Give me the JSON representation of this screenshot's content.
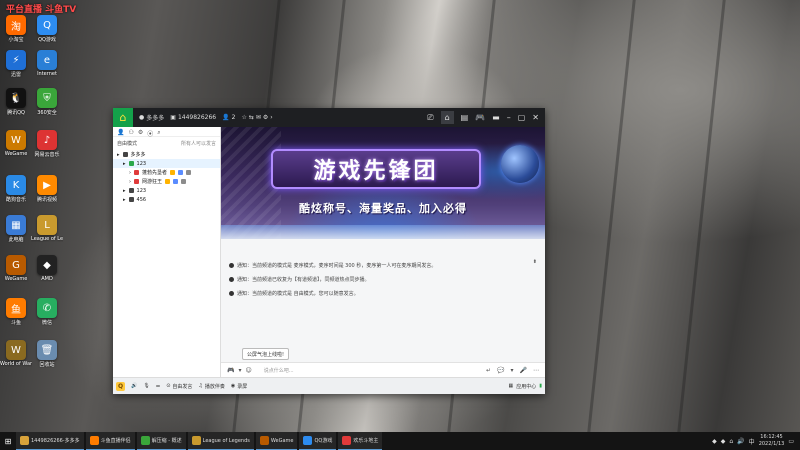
{
  "overlay": {
    "text": "平台直播 斗鱼TV"
  },
  "desktop_icons": [
    {
      "label": "小淘宝",
      "color": "#ff6a00",
      "glyph": "淘"
    },
    {
      "label": "QQ游戏",
      "color": "#2d8cf0",
      "glyph": "Q"
    },
    {
      "label": "迅雷",
      "color": "#1f6fd6",
      "glyph": "⚡"
    },
    {
      "label": "Internet",
      "color": "#2a7fd6",
      "glyph": "e"
    },
    {
      "label": "腾讯QQ",
      "color": "#111",
      "glyph": "🐧"
    },
    {
      "label": "360安全",
      "color": "#3aa63a",
      "glyph": "⛨"
    },
    {
      "label": "WeGame",
      "color": "#cc7a00",
      "glyph": "W"
    },
    {
      "label": "网易云音乐",
      "color": "#d33",
      "glyph": "♪"
    },
    {
      "label": "酷狗音乐",
      "color": "#2a8ae6",
      "glyph": "K"
    },
    {
      "label": "腾讯视频",
      "color": "#ff8a00",
      "glyph": "▶"
    },
    {
      "label": "此电脑",
      "color": "#3a7bd5",
      "glyph": "▦"
    },
    {
      "label": "League of Legends",
      "color": "#c99a2e",
      "glyph": "L"
    },
    {
      "label": "WeGame",
      "color": "#b85a00",
      "glyph": "G"
    },
    {
      "label": "AMD",
      "color": "#222",
      "glyph": "◆"
    },
    {
      "label": "斗鱼",
      "color": "#ff7c00",
      "glyph": "鱼"
    },
    {
      "label": "微信",
      "color": "#27ae60",
      "glyph": "✆"
    },
    {
      "label": "World of Warcraft",
      "color": "#8a6a20",
      "glyph": "W"
    },
    {
      "label": "回收站",
      "color": "#6a8caf",
      "glyph": "🗑"
    }
  ],
  "window": {
    "title_name": "多多多",
    "room_id": "1449826266",
    "members": "2",
    "tool_icons": [
      "screen-icon",
      "home-icon",
      "menu-icon",
      "gamepad-icon",
      "minimize-icon",
      "maximize-icon",
      "close-icon"
    ]
  },
  "left_pane": {
    "mode_label": "自由模式",
    "mode_link": "所有人可以发言",
    "tree": [
      {
        "label": "多多多",
        "level": 0,
        "color": "#444"
      },
      {
        "label": "123",
        "level": 1,
        "color": "#2aa84a",
        "selected": true
      },
      {
        "label": "蓬勃先垦者",
        "level": 2,
        "color": "#e03a3a"
      },
      {
        "label": "网游狂王",
        "level": 2,
        "color": "#e03a3a"
      },
      {
        "label": "123",
        "level": 1,
        "color": "#444"
      },
      {
        "label": "456",
        "level": 1,
        "color": "#444"
      }
    ]
  },
  "banner": {
    "title": "游戏先锋团",
    "tagline": "酷炫称号、海量奖品、加入必得"
  },
  "notices": [
    "通知：当前频道的模式是 麦序模式，麦序时间是 300 秒，麦序第一人可在麦序期间发言。",
    "通知：当前频道已收复为【有道频道】，同频道热点同步播。",
    "通知：当前频道的模式是 自由模式，您可以随意发言。"
  ],
  "tooltip": "公屏气泡上线啦!",
  "input": {
    "placeholder": "说点什么吧..."
  },
  "bottom_bar": {
    "q_label": "Q",
    "items": [
      "自由发言",
      "播放伴奏",
      "录屏"
    ],
    "app_center": "应用中心"
  },
  "taskbar": {
    "items": [
      {
        "label": "1449826266-多多多",
        "color": "#d8a23a"
      },
      {
        "label": "斗鱼直播伴侣",
        "color": "#ff7c00"
      },
      {
        "label": "解压缩 - 概述",
        "color": "#3aa63a"
      },
      {
        "label": "League of Legends",
        "color": "#c99a2e"
      },
      {
        "label": "WeGame",
        "color": "#b85a00"
      },
      {
        "label": "QQ游戏",
        "color": "#2d8cf0"
      },
      {
        "label": "欢乐斗地主",
        "color": "#e03a3a"
      }
    ],
    "time": "16:12:45",
    "date": "2022/1/13"
  }
}
